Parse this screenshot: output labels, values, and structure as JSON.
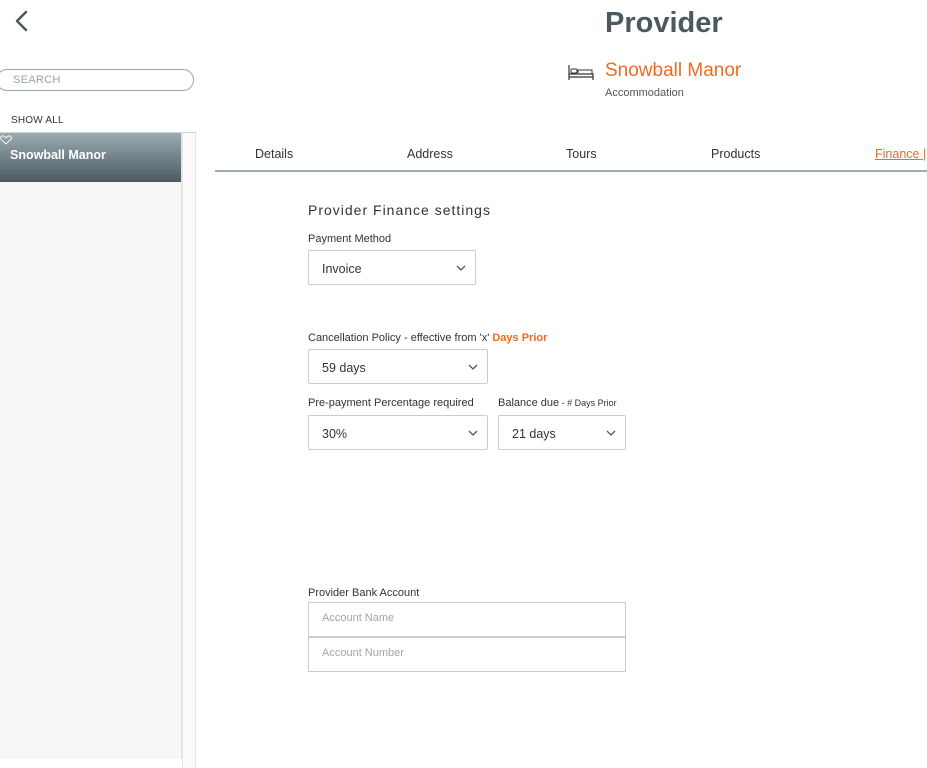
{
  "sidebar": {
    "search_placeholder": "SEARCH",
    "show_all": "SHOW ALL",
    "items": [
      {
        "label": "Snowball Manor"
      }
    ]
  },
  "header": {
    "title": "Provider",
    "provider_name": "Snowball Manor",
    "provider_type": "Accommodation"
  },
  "tabs": [
    {
      "label": "Details"
    },
    {
      "label": "Address"
    },
    {
      "label": "Tours"
    },
    {
      "label": "Products"
    },
    {
      "label": "Finance |"
    }
  ],
  "finance": {
    "section_title": "Provider Finance settings",
    "payment_method": {
      "label": "Payment Method",
      "value": "Invoice"
    },
    "cancellation": {
      "label": "Cancellation Policy - effective from 'x'",
      "label_accent": "Days Prior",
      "value": "59 days"
    },
    "prepayment": {
      "label": "Pre-payment Percentage required",
      "value": "30%"
    },
    "balance_due": {
      "label": "Balance due",
      "label_small": " - # Days Prior",
      "value": "21 days"
    },
    "bank": {
      "label": "Provider Bank Account",
      "account_name_placeholder": "Account Name",
      "account_number_placeholder": "Account Number"
    }
  },
  "colors": {
    "accent": "#f26a21",
    "title": "#4b5a60",
    "tab_rule": "#9aaeb3"
  }
}
